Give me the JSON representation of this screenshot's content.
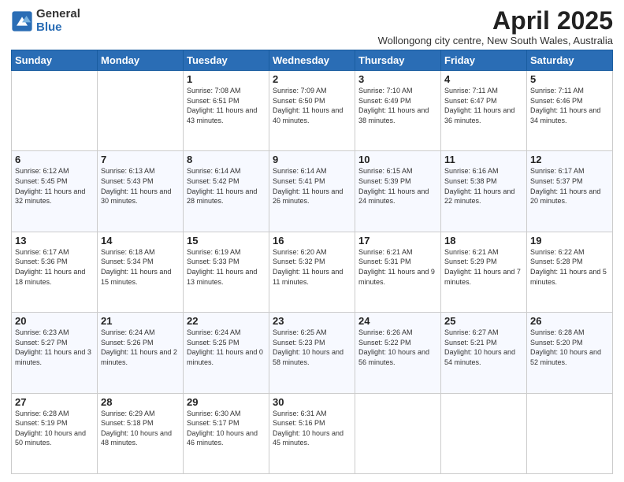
{
  "logo": {
    "general": "General",
    "blue": "Blue"
  },
  "title": "April 2025",
  "subtitle": "Wollongong city centre, New South Wales, Australia",
  "days": [
    "Sunday",
    "Monday",
    "Tuesday",
    "Wednesday",
    "Thursday",
    "Friday",
    "Saturday"
  ],
  "weeks": [
    [
      {
        "day": "",
        "info": ""
      },
      {
        "day": "",
        "info": ""
      },
      {
        "day": "1",
        "info": "Sunrise: 7:08 AM\nSunset: 6:51 PM\nDaylight: 11 hours and 43 minutes."
      },
      {
        "day": "2",
        "info": "Sunrise: 7:09 AM\nSunset: 6:50 PM\nDaylight: 11 hours and 40 minutes."
      },
      {
        "day": "3",
        "info": "Sunrise: 7:10 AM\nSunset: 6:49 PM\nDaylight: 11 hours and 38 minutes."
      },
      {
        "day": "4",
        "info": "Sunrise: 7:11 AM\nSunset: 6:47 PM\nDaylight: 11 hours and 36 minutes."
      },
      {
        "day": "5",
        "info": "Sunrise: 7:11 AM\nSunset: 6:46 PM\nDaylight: 11 hours and 34 minutes."
      }
    ],
    [
      {
        "day": "6",
        "info": "Sunrise: 6:12 AM\nSunset: 5:45 PM\nDaylight: 11 hours and 32 minutes."
      },
      {
        "day": "7",
        "info": "Sunrise: 6:13 AM\nSunset: 5:43 PM\nDaylight: 11 hours and 30 minutes."
      },
      {
        "day": "8",
        "info": "Sunrise: 6:14 AM\nSunset: 5:42 PM\nDaylight: 11 hours and 28 minutes."
      },
      {
        "day": "9",
        "info": "Sunrise: 6:14 AM\nSunset: 5:41 PM\nDaylight: 11 hours and 26 minutes."
      },
      {
        "day": "10",
        "info": "Sunrise: 6:15 AM\nSunset: 5:39 PM\nDaylight: 11 hours and 24 minutes."
      },
      {
        "day": "11",
        "info": "Sunrise: 6:16 AM\nSunset: 5:38 PM\nDaylight: 11 hours and 22 minutes."
      },
      {
        "day": "12",
        "info": "Sunrise: 6:17 AM\nSunset: 5:37 PM\nDaylight: 11 hours and 20 minutes."
      }
    ],
    [
      {
        "day": "13",
        "info": "Sunrise: 6:17 AM\nSunset: 5:36 PM\nDaylight: 11 hours and 18 minutes."
      },
      {
        "day": "14",
        "info": "Sunrise: 6:18 AM\nSunset: 5:34 PM\nDaylight: 11 hours and 15 minutes."
      },
      {
        "day": "15",
        "info": "Sunrise: 6:19 AM\nSunset: 5:33 PM\nDaylight: 11 hours and 13 minutes."
      },
      {
        "day": "16",
        "info": "Sunrise: 6:20 AM\nSunset: 5:32 PM\nDaylight: 11 hours and 11 minutes."
      },
      {
        "day": "17",
        "info": "Sunrise: 6:21 AM\nSunset: 5:31 PM\nDaylight: 11 hours and 9 minutes."
      },
      {
        "day": "18",
        "info": "Sunrise: 6:21 AM\nSunset: 5:29 PM\nDaylight: 11 hours and 7 minutes."
      },
      {
        "day": "19",
        "info": "Sunrise: 6:22 AM\nSunset: 5:28 PM\nDaylight: 11 hours and 5 minutes."
      }
    ],
    [
      {
        "day": "20",
        "info": "Sunrise: 6:23 AM\nSunset: 5:27 PM\nDaylight: 11 hours and 3 minutes."
      },
      {
        "day": "21",
        "info": "Sunrise: 6:24 AM\nSunset: 5:26 PM\nDaylight: 11 hours and 2 minutes."
      },
      {
        "day": "22",
        "info": "Sunrise: 6:24 AM\nSunset: 5:25 PM\nDaylight: 11 hours and 0 minutes."
      },
      {
        "day": "23",
        "info": "Sunrise: 6:25 AM\nSunset: 5:23 PM\nDaylight: 10 hours and 58 minutes."
      },
      {
        "day": "24",
        "info": "Sunrise: 6:26 AM\nSunset: 5:22 PM\nDaylight: 10 hours and 56 minutes."
      },
      {
        "day": "25",
        "info": "Sunrise: 6:27 AM\nSunset: 5:21 PM\nDaylight: 10 hours and 54 minutes."
      },
      {
        "day": "26",
        "info": "Sunrise: 6:28 AM\nSunset: 5:20 PM\nDaylight: 10 hours and 52 minutes."
      }
    ],
    [
      {
        "day": "27",
        "info": "Sunrise: 6:28 AM\nSunset: 5:19 PM\nDaylight: 10 hours and 50 minutes."
      },
      {
        "day": "28",
        "info": "Sunrise: 6:29 AM\nSunset: 5:18 PM\nDaylight: 10 hours and 48 minutes."
      },
      {
        "day": "29",
        "info": "Sunrise: 6:30 AM\nSunset: 5:17 PM\nDaylight: 10 hours and 46 minutes."
      },
      {
        "day": "30",
        "info": "Sunrise: 6:31 AM\nSunset: 5:16 PM\nDaylight: 10 hours and 45 minutes."
      },
      {
        "day": "",
        "info": ""
      },
      {
        "day": "",
        "info": ""
      },
      {
        "day": "",
        "info": ""
      }
    ]
  ]
}
